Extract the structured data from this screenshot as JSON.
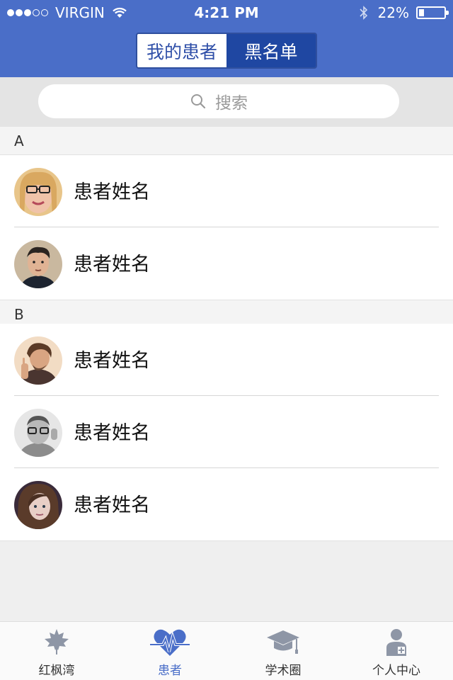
{
  "status_bar": {
    "carrier": "VIRGIN",
    "time": "4:21 PM",
    "battery": "22%",
    "battery_level": 0.22,
    "signal_dots": [
      true,
      true,
      true,
      false,
      false
    ]
  },
  "header": {
    "tabs": [
      {
        "label": "我的患者",
        "active": true
      },
      {
        "label": "黑名单",
        "active": false
      }
    ]
  },
  "search": {
    "placeholder": "搜索"
  },
  "sections": [
    {
      "letter": "A",
      "patients": [
        {
          "name": "患者姓名"
        },
        {
          "name": "患者姓名"
        }
      ]
    },
    {
      "letter": "B",
      "patients": [
        {
          "name": "患者姓名"
        },
        {
          "name": "患者姓名"
        },
        {
          "name": "患者姓名"
        }
      ]
    }
  ],
  "tabbar": {
    "items": [
      {
        "label": "红枫湾",
        "icon": "maple-leaf-icon",
        "active": false
      },
      {
        "label": "患者",
        "icon": "heart-pulse-icon",
        "active": true
      },
      {
        "label": "学术圈",
        "icon": "graduation-cap-icon",
        "active": false
      },
      {
        "label": "个人中心",
        "icon": "doctor-profile-icon",
        "active": false
      }
    ]
  },
  "colors": {
    "accent": "#4a6ec8",
    "segment_dark": "#1f47a2",
    "icon_gray": "#8e96a6"
  }
}
